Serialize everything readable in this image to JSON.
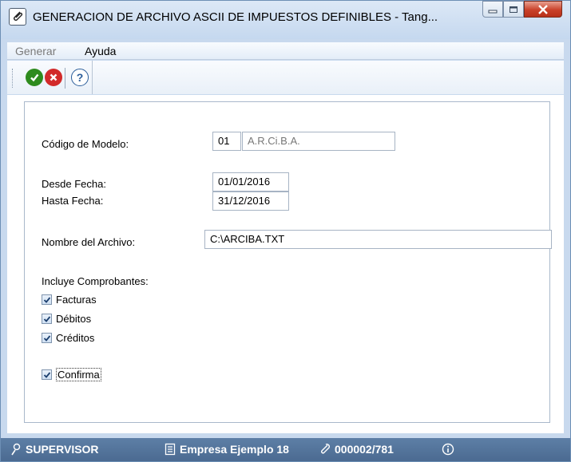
{
  "window": {
    "title": "GENERACION DE ARCHIVO ASCII DE IMPUESTOS DEFINIBLES - Tang..."
  },
  "menu": {
    "items": [
      "Generar",
      "Ayuda"
    ]
  },
  "toolbar": {
    "buttons": [
      {
        "icon": "check-icon",
        "color": "#2e8b1e"
      },
      {
        "icon": "cancel-icon",
        "color": "#d22a2a"
      },
      {
        "icon": "help-icon",
        "color": "#2b5d9a"
      }
    ]
  },
  "form": {
    "codigo_label": "Código de Modelo:",
    "codigo_value": "01",
    "codigo_desc": "A.R.Ci.B.A.",
    "desde_label": "Desde Fecha:",
    "desde_value": "01/01/2016",
    "hasta_label": "Hasta Fecha:",
    "hasta_value": "31/12/2016",
    "archivo_label": "Nombre del Archivo:",
    "archivo_value": "C:\\ARCIBA.TXT",
    "incluye_label": "Incluye Comprobantes:",
    "checks": [
      {
        "label": "Facturas",
        "checked": true
      },
      {
        "label": "Débitos",
        "checked": true
      },
      {
        "label": "Créditos",
        "checked": true
      }
    ],
    "confirma_label": "Confirma",
    "confirma_checked": true
  },
  "status": {
    "user": "SUPERVISOR",
    "company": "Empresa Ejemplo 18",
    "code": "000002/781"
  }
}
